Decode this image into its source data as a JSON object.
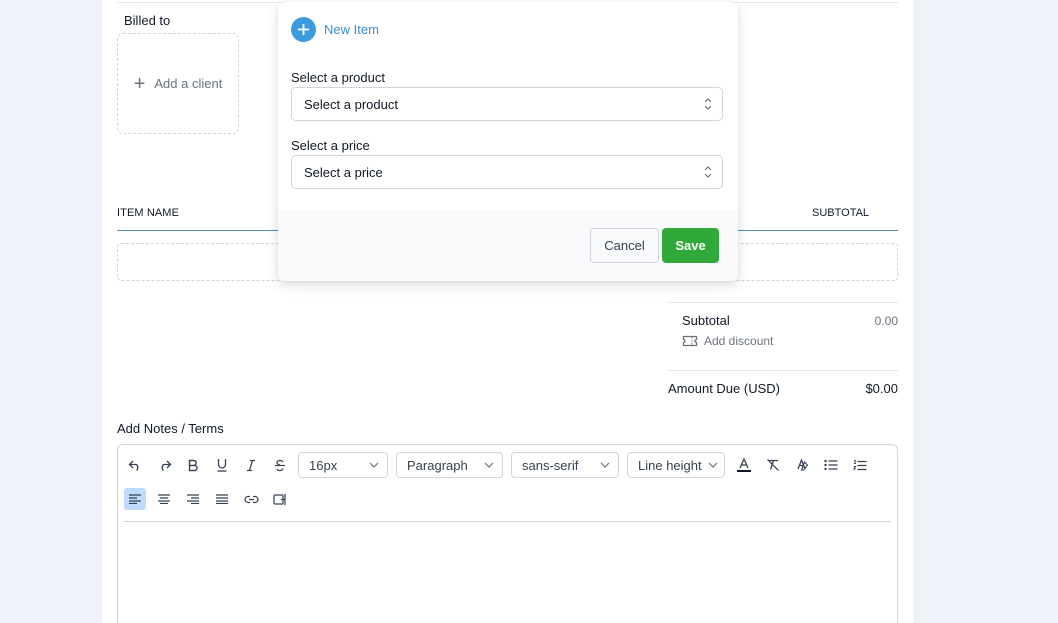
{
  "invoice": {
    "billed_to_label": "Billed to",
    "add_client_label": "Add a client",
    "columns": {
      "item_name": "ITEM NAME",
      "subtotal": "SUBTOTAL"
    },
    "totals": {
      "subtotal_label": "Subtotal",
      "subtotal_value": "0.00",
      "add_discount_label": "Add discount",
      "amount_due_label": "Amount Due (USD)",
      "amount_due_value": "$0.00"
    },
    "notes_label": "Add Notes / Terms"
  },
  "editor_toolbar": {
    "font_size": "16px",
    "block_type": "Paragraph",
    "font_family": "sans-serif",
    "line_height": "Line height"
  },
  "new_item_popover": {
    "title": "New Item",
    "product_label": "Select a product",
    "product_value": "Select a product",
    "price_label": "Select a price",
    "price_value": "Select a price",
    "cancel_label": "Cancel",
    "save_label": "Save"
  },
  "colors": {
    "accent_blue": "#3b9be0",
    "save_green": "#2faa3a",
    "page_bg": "#eff2f8"
  }
}
